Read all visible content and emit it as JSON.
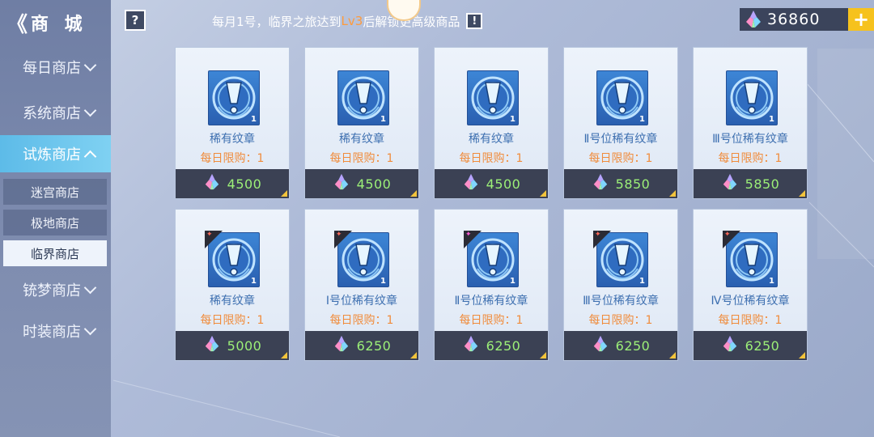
{
  "sidebar": {
    "back_label": "商 城",
    "categories": [
      {
        "label": "每日商店",
        "expanded": false
      },
      {
        "label": "系统商店",
        "expanded": false
      },
      {
        "label": "试炼商店",
        "expanded": true
      },
      {
        "label": "铳梦商店",
        "expanded": false
      },
      {
        "label": "时装商店",
        "expanded": false
      }
    ],
    "subitems": [
      {
        "label": "迷宫商店",
        "selected": false
      },
      {
        "label": "极地商店",
        "selected": false
      },
      {
        "label": "临界商店",
        "selected": true
      }
    ]
  },
  "header": {
    "help_label": "?",
    "notice_prefix": "每月1号，临界之旅达到",
    "notice_level": "Lv3",
    "notice_suffix": "后解锁更高级商品",
    "notice_icon": "!",
    "currency_amount": "36860",
    "plus_label": "+"
  },
  "items": [
    {
      "name": "稀有纹章",
      "limit": "每日限购：1",
      "price": "4500",
      "count": "1",
      "badge": ""
    },
    {
      "name": "稀有纹章",
      "limit": "每日限购：1",
      "price": "4500",
      "count": "1",
      "badge": ""
    },
    {
      "name": "稀有纹章",
      "limit": "每日限购：1",
      "price": "4500",
      "count": "1",
      "badge": ""
    },
    {
      "name": "Ⅱ号位稀有纹章",
      "limit": "每日限购：1",
      "price": "5850",
      "count": "1",
      "badge": ""
    },
    {
      "name": "Ⅲ号位稀有纹章",
      "limit": "每日限购：1",
      "price": "5850",
      "count": "1",
      "badge": ""
    },
    {
      "name": "稀有纹章",
      "limit": "每日限购：1",
      "price": "5000",
      "count": "1",
      "badge": "red"
    },
    {
      "name": "Ⅰ号位稀有纹章",
      "limit": "每日限购：1",
      "price": "6250",
      "count": "1",
      "badge": "red"
    },
    {
      "name": "Ⅱ号位稀有纹章",
      "limit": "每日限购：1",
      "price": "6250",
      "count": "1",
      "badge": "pink"
    },
    {
      "name": "Ⅲ号位稀有纹章",
      "limit": "每日限购：1",
      "price": "6250",
      "count": "1",
      "badge": "red"
    },
    {
      "name": "Ⅳ号位稀有纹章",
      "limit": "每日限购：1",
      "price": "6250",
      "count": "1",
      "badge": "red"
    }
  ],
  "colors": {
    "accent_active": "#5dbbe8",
    "price_green": "#9cf078",
    "limit_orange": "#f08c3c",
    "name_blue": "#3d6fb0",
    "level_orange": "#ff9b3b",
    "plus_yellow": "#f6c21d"
  },
  "icons": {
    "currency": "crystal-icon",
    "item": "emblem-icon",
    "help": "question-icon",
    "notice": "exclamation-icon"
  }
}
